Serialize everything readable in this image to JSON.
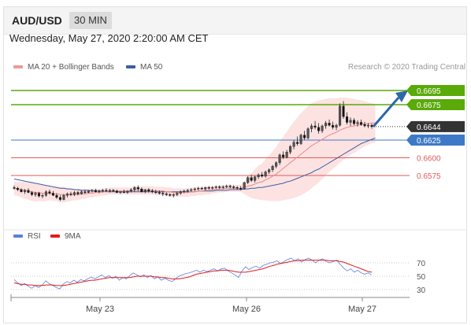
{
  "header": {
    "pair": "AUD/USD",
    "timeframe": "30 MIN"
  },
  "datetime": "Wednesday, May 27, 2020 2:20:00 AM CET",
  "legend": {
    "ma20_bb": "MA 20 + Bollinger Bands",
    "ma50": "MA 50",
    "rsi": "RSI",
    "rsi_ma": "9MA"
  },
  "credit": "Research © 2020 Trading Central",
  "colors": {
    "bull_levels": "#5aaa0a",
    "pivot": "#3d79c6",
    "support": "#e05a5a",
    "last_price_bg": "#333333",
    "ma20": "#e88a8a",
    "ma50": "#3b5fa0",
    "band_fill": "#fde2e2",
    "rsi_line": "#5b7fdc",
    "rsi_ma_line": "#e21c1c",
    "arrow": "#2e67a8"
  },
  "chart_data": [
    {
      "type": "candlestick",
      "x_tick_labels": [
        "May 23",
        "May 26",
        "May 27"
      ],
      "y_range": [
        0.6535,
        0.6713
      ],
      "ohlc": [
        [
          0.6558,
          0.6561,
          0.6555,
          0.6557
        ],
        [
          0.6557,
          0.6559,
          0.6553,
          0.6555
        ],
        [
          0.6555,
          0.6557,
          0.6551,
          0.6552
        ],
        [
          0.6552,
          0.6556,
          0.6549,
          0.6554
        ],
        [
          0.6554,
          0.6557,
          0.655,
          0.6551
        ],
        [
          0.6551,
          0.6553,
          0.6546,
          0.6548
        ],
        [
          0.6548,
          0.6552,
          0.6545,
          0.655
        ],
        [
          0.655,
          0.6552,
          0.6544,
          0.6546
        ],
        [
          0.6546,
          0.6549,
          0.6543,
          0.6547
        ],
        [
          0.6547,
          0.6554,
          0.6545,
          0.6552
        ],
        [
          0.6552,
          0.6555,
          0.6548,
          0.655
        ],
        [
          0.655,
          0.6553,
          0.6546,
          0.6547
        ],
        [
          0.6547,
          0.655,
          0.6542,
          0.6544
        ],
        [
          0.6544,
          0.6547,
          0.6539,
          0.6541
        ],
        [
          0.6541,
          0.6549,
          0.654,
          0.6547
        ],
        [
          0.6547,
          0.6551,
          0.6544,
          0.6549
        ],
        [
          0.6549,
          0.6552,
          0.6546,
          0.6548
        ],
        [
          0.6548,
          0.6553,
          0.6546,
          0.6551
        ],
        [
          0.6551,
          0.6553,
          0.6547,
          0.6549
        ],
        [
          0.6549,
          0.6554,
          0.6548,
          0.6552
        ],
        [
          0.6552,
          0.6555,
          0.6549,
          0.6551
        ],
        [
          0.6551,
          0.6554,
          0.655,
          0.6553
        ],
        [
          0.6553,
          0.6556,
          0.6551,
          0.6554
        ],
        [
          0.6554,
          0.6556,
          0.6551,
          0.6552
        ],
        [
          0.6552,
          0.6555,
          0.655,
          0.6553
        ],
        [
          0.6553,
          0.6556,
          0.6551,
          0.6554
        ],
        [
          0.6554,
          0.6557,
          0.6552,
          0.6553
        ],
        [
          0.6553,
          0.6556,
          0.6551,
          0.6554
        ],
        [
          0.6554,
          0.6556,
          0.6552,
          0.6553
        ],
        [
          0.6553,
          0.6555,
          0.655,
          0.6551
        ],
        [
          0.6551,
          0.6553,
          0.6549,
          0.6552
        ],
        [
          0.6552,
          0.6555,
          0.655,
          0.6551
        ],
        [
          0.6551,
          0.6554,
          0.6549,
          0.6553
        ],
        [
          0.6553,
          0.6557,
          0.6551,
          0.6555
        ],
        [
          0.6555,
          0.656,
          0.6552,
          0.6558
        ],
        [
          0.6558,
          0.6561,
          0.6553,
          0.6556
        ],
        [
          0.6556,
          0.6558,
          0.6551,
          0.6552
        ],
        [
          0.6552,
          0.6556,
          0.655,
          0.6555
        ],
        [
          0.6555,
          0.6557,
          0.6551,
          0.6553
        ],
        [
          0.6553,
          0.6556,
          0.655,
          0.6552
        ],
        [
          0.6552,
          0.6555,
          0.6549,
          0.6551
        ],
        [
          0.6551,
          0.6554,
          0.6548,
          0.655
        ],
        [
          0.655,
          0.6553,
          0.6546,
          0.6549
        ],
        [
          0.6549,
          0.6551,
          0.6546,
          0.6548
        ],
        [
          0.6548,
          0.655,
          0.6545,
          0.6547
        ],
        [
          0.6547,
          0.655,
          0.6544,
          0.6548
        ],
        [
          0.6548,
          0.6552,
          0.6546,
          0.655
        ],
        [
          0.655,
          0.6554,
          0.6548,
          0.6552
        ],
        [
          0.6552,
          0.6555,
          0.655,
          0.6553
        ],
        [
          0.6553,
          0.6556,
          0.6551,
          0.6554
        ],
        [
          0.6554,
          0.6557,
          0.6552,
          0.6555
        ],
        [
          0.6555,
          0.6558,
          0.6553,
          0.6556
        ],
        [
          0.6556,
          0.6559,
          0.6554,
          0.6557
        ],
        [
          0.6557,
          0.6559,
          0.6555,
          0.6556
        ],
        [
          0.6556,
          0.6559,
          0.6554,
          0.6558
        ],
        [
          0.6558,
          0.656,
          0.6555,
          0.6557
        ],
        [
          0.6557,
          0.656,
          0.6555,
          0.6558
        ],
        [
          0.6558,
          0.6561,
          0.6556,
          0.6559
        ],
        [
          0.6559,
          0.6561,
          0.6556,
          0.6558
        ],
        [
          0.6558,
          0.6561,
          0.6556,
          0.6559
        ],
        [
          0.6559,
          0.6562,
          0.6557,
          0.656
        ],
        [
          0.656,
          0.6562,
          0.6557,
          0.6559
        ],
        [
          0.6559,
          0.6561,
          0.6556,
          0.6558
        ],
        [
          0.6558,
          0.656,
          0.6555,
          0.6557
        ],
        [
          0.6557,
          0.656,
          0.6554,
          0.6556
        ],
        [
          0.6556,
          0.6566,
          0.6555,
          0.6565
        ],
        [
          0.6565,
          0.6574,
          0.6563,
          0.6572
        ],
        [
          0.6572,
          0.6576,
          0.6566,
          0.6568
        ],
        [
          0.6568,
          0.6575,
          0.6565,
          0.6573
        ],
        [
          0.6573,
          0.6578,
          0.657,
          0.6576
        ],
        [
          0.6576,
          0.658,
          0.6572,
          0.6574
        ],
        [
          0.6574,
          0.6582,
          0.6572,
          0.658
        ],
        [
          0.658,
          0.6585,
          0.6577,
          0.6583
        ],
        [
          0.6583,
          0.659,
          0.658,
          0.6588
        ],
        [
          0.6588,
          0.6595,
          0.6585,
          0.6593
        ],
        [
          0.6593,
          0.6606,
          0.659,
          0.6604
        ],
        [
          0.6604,
          0.6609,
          0.6598,
          0.6601
        ],
        [
          0.6601,
          0.6611,
          0.6599,
          0.6608
        ],
        [
          0.6608,
          0.6618,
          0.6605,
          0.6616
        ],
        [
          0.6616,
          0.6625,
          0.6612,
          0.6622
        ],
        [
          0.6622,
          0.663,
          0.6617,
          0.662
        ],
        [
          0.662,
          0.6634,
          0.6618,
          0.6632
        ],
        [
          0.6632,
          0.6638,
          0.6625,
          0.6628
        ],
        [
          0.6628,
          0.6643,
          0.6626,
          0.6641
        ],
        [
          0.6641,
          0.6648,
          0.6636,
          0.6645
        ],
        [
          0.6645,
          0.6652,
          0.664,
          0.6643
        ],
        [
          0.6643,
          0.6649,
          0.6634,
          0.6638
        ],
        [
          0.6638,
          0.6647,
          0.6635,
          0.6645
        ],
        [
          0.6645,
          0.6652,
          0.6641,
          0.6649
        ],
        [
          0.6649,
          0.6654,
          0.6644,
          0.6646
        ],
        [
          0.6646,
          0.6651,
          0.664,
          0.6643
        ],
        [
          0.6643,
          0.6648,
          0.6639,
          0.6646
        ],
        [
          0.6646,
          0.6677,
          0.6644,
          0.6673
        ],
        [
          0.6673,
          0.668,
          0.6655,
          0.6658
        ],
        [
          0.6658,
          0.6664,
          0.6647,
          0.665
        ],
        [
          0.665,
          0.6657,
          0.6645,
          0.6653
        ],
        [
          0.6653,
          0.6656,
          0.6646,
          0.6648
        ],
        [
          0.6648,
          0.6653,
          0.6644,
          0.665
        ],
        [
          0.665,
          0.6654,
          0.6645,
          0.6647
        ],
        [
          0.6647,
          0.6651,
          0.6643,
          0.6645
        ],
        [
          0.6645,
          0.6649,
          0.6642,
          0.6646
        ],
        [
          0.6646,
          0.6648,
          0.6641,
          0.6644
        ]
      ],
      "ma20": [
        0.6557,
        0.6556,
        0.6555,
        0.6554,
        0.6553,
        0.6552,
        0.6551,
        0.6551,
        0.655,
        0.655,
        0.655,
        0.6549,
        0.6549,
        0.6548,
        0.6548,
        0.6548,
        0.6548,
        0.6548,
        0.6548,
        0.6549,
        0.6549,
        0.655,
        0.655,
        0.6551,
        0.6551,
        0.6552,
        0.6552,
        0.6553,
        0.6553,
        0.6553,
        0.6553,
        0.6553,
        0.6553,
        0.6553,
        0.6554,
        0.6554,
        0.6554,
        0.6554,
        0.6554,
        0.6554,
        0.6553,
        0.6553,
        0.6553,
        0.6552,
        0.6552,
        0.6551,
        0.6551,
        0.6551,
        0.6551,
        0.6551,
        0.6552,
        0.6552,
        0.6553,
        0.6553,
        0.6554,
        0.6554,
        0.6555,
        0.6555,
        0.6556,
        0.6556,
        0.6557,
        0.6557,
        0.6557,
        0.6557,
        0.6557,
        0.6558,
        0.656,
        0.6561,
        0.6563,
        0.6565,
        0.6566,
        0.6569,
        0.6571,
        0.6574,
        0.6577,
        0.6581,
        0.6585,
        0.6589,
        0.6593,
        0.6597,
        0.6601,
        0.6605,
        0.6609,
        0.6613,
        0.6617,
        0.662,
        0.6623,
        0.6626,
        0.6629,
        0.6632,
        0.6634,
        0.6636,
        0.6639,
        0.6641,
        0.6643,
        0.6644,
        0.6645,
        0.6646,
        0.6647,
        0.6648,
        0.6648,
        0.6649,
        0.6649
      ],
      "ma50": [
        0.657,
        0.6569,
        0.6568,
        0.6567,
        0.6566,
        0.6565,
        0.6564,
        0.6563,
        0.6562,
        0.6561,
        0.656,
        0.6559,
        0.6558,
        0.6557,
        0.6557,
        0.6556,
        0.6556,
        0.6555,
        0.6555,
        0.6554,
        0.6554,
        0.6554,
        0.6553,
        0.6553,
        0.6553,
        0.6553,
        0.6552,
        0.6552,
        0.6552,
        0.6552,
        0.6552,
        0.6552,
        0.6552,
        0.6552,
        0.6552,
        0.6552,
        0.6552,
        0.6552,
        0.6552,
        0.6552,
        0.6552,
        0.6552,
        0.6552,
        0.6552,
        0.6552,
        0.6552,
        0.6552,
        0.6552,
        0.6552,
        0.6552,
        0.6552,
        0.6552,
        0.6553,
        0.6553,
        0.6553,
        0.6553,
        0.6553,
        0.6554,
        0.6554,
        0.6554,
        0.6554,
        0.6555,
        0.6555,
        0.6555,
        0.6555,
        0.6556,
        0.6556,
        0.6557,
        0.6557,
        0.6558,
        0.6558,
        0.6559,
        0.656,
        0.6561,
        0.6562,
        0.6563,
        0.6564,
        0.6566,
        0.6567,
        0.6569,
        0.6571,
        0.6573,
        0.6575,
        0.6577,
        0.6579,
        0.6582,
        0.6584,
        0.6587,
        0.659,
        0.6593,
        0.6596,
        0.6599,
        0.6602,
        0.6605,
        0.6608,
        0.6611,
        0.6614,
        0.6617,
        0.662,
        0.6622,
        0.6624,
        0.6626,
        0.6628
      ],
      "bb_width": [
        0.001,
        0.001,
        0.0011,
        0.0012,
        0.0012,
        0.0013,
        0.0013,
        0.0012,
        0.0012,
        0.0011,
        0.001,
        0.001,
        0.001,
        0.0011,
        0.0011,
        0.001,
        0.0009,
        0.0008,
        0.0008,
        0.0007,
        0.0007,
        0.0006,
        0.0006,
        0.0006,
        0.0005,
        0.0005,
        0.0005,
        0.0005,
        0.0005,
        0.0005,
        0.0005,
        0.0005,
        0.0005,
        0.0005,
        0.0006,
        0.0006,
        0.0006,
        0.0006,
        0.0006,
        0.0006,
        0.0006,
        0.0006,
        0.0006,
        0.0006,
        0.0006,
        0.0006,
        0.0006,
        0.0006,
        0.0006,
        0.0006,
        0.0006,
        0.0006,
        0.0006,
        0.0006,
        0.0006,
        0.0006,
        0.0005,
        0.0005,
        0.0005,
        0.0005,
        0.0005,
        0.0005,
        0.0005,
        0.0005,
        0.0005,
        0.0009,
        0.0014,
        0.0018,
        0.0021,
        0.0024,
        0.0026,
        0.0029,
        0.0032,
        0.0035,
        0.0038,
        0.0042,
        0.0045,
        0.0048,
        0.0051,
        0.0054,
        0.0056,
        0.0058,
        0.0059,
        0.006,
        0.006,
        0.0059,
        0.0058,
        0.0056,
        0.0054,
        0.0052,
        0.005,
        0.0048,
        0.0046,
        0.0044,
        0.0042,
        0.004,
        0.0038,
        0.0036,
        0.0034,
        0.0032,
        0.003,
        0.0028,
        0.0027
      ],
      "levels": [
        {
          "value": 0.6695,
          "label": "0.6695",
          "kind": "resistance"
        },
        {
          "value": 0.6675,
          "label": "0.6675",
          "kind": "resistance"
        },
        {
          "value": 0.6644,
          "label": "0.6644",
          "kind": "last"
        },
        {
          "value": 0.6625,
          "label": "0.6625",
          "kind": "pivot"
        },
        {
          "value": 0.66,
          "label": "0.6600",
          "kind": "support"
        },
        {
          "value": 0.6575,
          "label": "0.6575",
          "kind": "support"
        }
      ],
      "projection_arrow": {
        "from": 0.6644,
        "to": 0.6695
      }
    },
    {
      "type": "line",
      "y_tick_labels": [
        "70",
        "50",
        "30"
      ],
      "y_range": [
        20,
        90
      ],
      "series": [
        {
          "name": "RSI",
          "values": [
            45,
            40,
            36,
            39,
            35,
            32,
            36,
            33,
            37,
            43,
            39,
            36,
            33,
            31,
            38,
            42,
            40,
            44,
            41,
            45,
            43,
            46,
            49,
            46,
            49,
            52,
            48,
            51,
            47,
            50,
            44,
            48,
            46,
            51,
            55,
            52,
            49,
            52,
            48,
            51,
            46,
            49,
            44,
            47,
            44,
            42,
            46,
            50,
            52,
            54,
            55,
            57,
            59,
            56,
            59,
            57,
            59,
            61,
            58,
            61,
            62,
            58,
            55,
            52,
            48,
            58,
            64,
            60,
            63,
            65,
            62,
            66,
            68,
            70,
            71,
            73,
            69,
            72,
            75,
            77,
            73,
            76,
            71,
            75,
            77,
            74,
            70,
            74,
            76,
            72,
            70,
            72,
            74,
            68,
            62,
            58,
            61,
            56,
            59,
            55,
            53,
            55,
            52
          ]
        },
        {
          "name": "9MA",
          "values": [
            40,
            39,
            38,
            38,
            37,
            37,
            36,
            36,
            36,
            37,
            37,
            37,
            36,
            36,
            36,
            37,
            38,
            39,
            40,
            41,
            42,
            43,
            44,
            44,
            45,
            46,
            47,
            48,
            48,
            48,
            48,
            48,
            48,
            48,
            49,
            50,
            50,
            50,
            50,
            50,
            49,
            49,
            48,
            48,
            47,
            46,
            46,
            46,
            47,
            48,
            49,
            51,
            53,
            54,
            55,
            56,
            57,
            58,
            58,
            59,
            59,
            59,
            58,
            57,
            56,
            56,
            56,
            57,
            58,
            59,
            60,
            61,
            63,
            65,
            66,
            68,
            69,
            70,
            71,
            72,
            73,
            73,
            74,
            74,
            74,
            74,
            74,
            74,
            74,
            74,
            73,
            73,
            73,
            72,
            71,
            69,
            67,
            65,
            63,
            61,
            59,
            57,
            56
          ]
        }
      ]
    }
  ]
}
